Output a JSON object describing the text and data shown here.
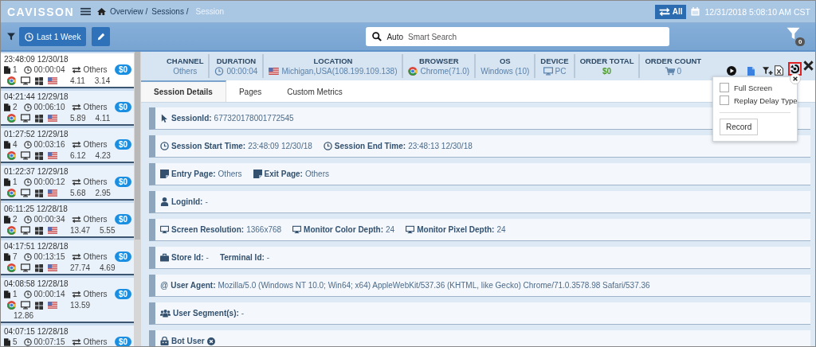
{
  "header": {
    "logo": "CAVISSON",
    "breadcrumb": [
      {
        "label": "Overview /",
        "current": false
      },
      {
        "label": "Sessions /",
        "current": false
      },
      {
        "label": "Session",
        "current": true
      }
    ],
    "all_button": "All",
    "datetime": "12/31/2018 5:08:10 AM CST"
  },
  "toolbar": {
    "time_filter": "Last 1 Week",
    "search": {
      "prefix": "Auto",
      "placeholder": "Smart Search"
    },
    "filter_count": "0"
  },
  "sessions": [
    {
      "time": "23:48:09 12/30/18",
      "pages": "1",
      "duration": "00:00:04",
      "channel": "Others",
      "metric_1": "4.11",
      "metric_2": "3.14",
      "amount": "$0",
      "selected": true
    },
    {
      "time": "04:21:44 12/29/18",
      "pages": "2",
      "duration": "00:06:10",
      "channel": "Others",
      "metric_1": "5.89",
      "metric_2": "4.11",
      "amount": "$0",
      "selected": false
    },
    {
      "time": "01:27:52 12/29/18",
      "pages": "4",
      "duration": "00:03:16",
      "channel": "Others",
      "metric_1": "6.12",
      "metric_2": "4.23",
      "amount": "$0",
      "selected": false
    },
    {
      "time": "01:22:37 12/29/18",
      "pages": "1",
      "duration": "00:00:12",
      "channel": "Others",
      "metric_1": "5.68",
      "metric_2": "2.95",
      "amount": "$0",
      "selected": false
    },
    {
      "time": "06:11:25 12/28/18",
      "pages": "2",
      "duration": "00:00:34",
      "channel": "Others",
      "metric_1": "13.47",
      "metric_2": "5.55",
      "amount": "$0",
      "selected": false
    },
    {
      "time": "04:17:51 12/28/18",
      "pages": "7",
      "duration": "00:13:15",
      "channel": "Others",
      "metric_1": "27.74",
      "metric_2": "4.69",
      "amount": "$0",
      "selected": false
    },
    {
      "time": "04:08:58 12/28/18",
      "pages": "1",
      "duration": "00:00:14",
      "channel": "Others",
      "metric_1": "13.59",
      "metric_2": "12.86",
      "amount": "$0",
      "selected": false
    },
    {
      "time": "04:07:15 12/28/18",
      "pages": "5",
      "duration": "00:07:15",
      "channel": "Others",
      "amount": "$0",
      "selected": false
    }
  ],
  "summary": [
    {
      "label": "CHANNEL",
      "value": "Others",
      "kind": "channel"
    },
    {
      "label": "DURATION",
      "value": "00:00:04",
      "kind": "duration"
    },
    {
      "label": "LOCATION",
      "value": "Michigan,USA(108.199.109.138)",
      "kind": "location"
    },
    {
      "label": "BROWSER",
      "value": "Chrome(71.0)",
      "kind": "browser"
    },
    {
      "label": "OS",
      "value": "Windows (10)",
      "kind": "os"
    },
    {
      "label": "DEVICE",
      "value": "PC",
      "kind": "device"
    },
    {
      "label": "ORDER TOTAL",
      "value": "$0",
      "kind": "amount"
    },
    {
      "label": "ORDER COUNT",
      "value": "0",
      "kind": "count"
    }
  ],
  "tabs": [
    {
      "label": "Session Details",
      "selected": true
    },
    {
      "label": "Pages",
      "selected": false
    },
    {
      "label": "Custom Metrics",
      "selected": false
    }
  ],
  "replay_menu": {
    "options": [
      {
        "label": "Full Screen",
        "checked": false
      },
      {
        "label": "Replay Delay Type",
        "checked": false
      }
    ],
    "button": "Record"
  },
  "details": [
    {
      "fields": [
        {
          "kind": "session_id",
          "label": "SessionId:",
          "value": "677320178001772545"
        }
      ]
    },
    {
      "fields": [
        {
          "kind": "time",
          "label": "Session Start Time:",
          "value": "23:48:09 12/30/18"
        },
        {
          "kind": "time",
          "label": "Session End Time:",
          "value": "23:48:13 12/30/18"
        }
      ]
    },
    {
      "fields": [
        {
          "kind": "page",
          "label": "Entry Page:",
          "value": "Others"
        },
        {
          "kind": "page",
          "label": "Exit Page:",
          "value": "Others"
        }
      ]
    },
    {
      "fields": [
        {
          "kind": "login",
          "label": "LoginId:",
          "value": "-"
        }
      ]
    },
    {
      "fields": [
        {
          "kind": "display",
          "label": "Screen Resolution:",
          "value": "1366x768"
        },
        {
          "kind": "display",
          "label": "Monitor Color Depth:",
          "value": "24"
        },
        {
          "kind": "display",
          "label": "Monitor Pixel Depth:",
          "value": "24"
        }
      ]
    },
    {
      "fields": [
        {
          "kind": "store",
          "label": "Store Id:",
          "value": "-"
        },
        {
          "kind": "terminal",
          "label": "Terminal Id:",
          "value": "-"
        }
      ]
    },
    {
      "fields": [
        {
          "kind": "agent",
          "glyph": "@",
          "label": "User Agent:",
          "value": "Mozilla/5.0 (Windows NT 10.0; Win64; x64) AppleWebKit/537.36 (KHTML, like Gecko) Chrome/71.0.3578.98 Safari/537.36"
        }
      ]
    },
    {
      "fields": [
        {
          "kind": "segment",
          "label": "User Segment(s):",
          "value": "-"
        }
      ]
    },
    {
      "fields": [
        {
          "kind": "bot",
          "label": "Bot User"
        }
      ]
    }
  ]
}
